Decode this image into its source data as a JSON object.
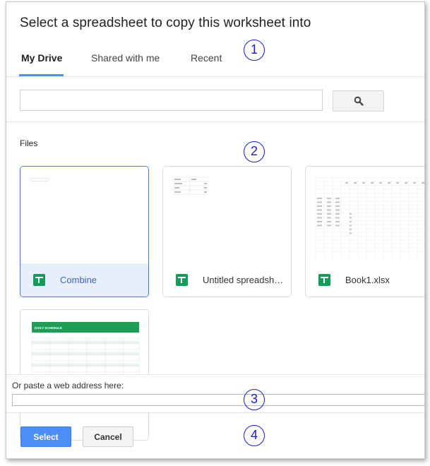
{
  "dialog": {
    "title": "Select a spreadsheet to copy this worksheet into"
  },
  "tabs": [
    {
      "label": "My Drive",
      "active": true
    },
    {
      "label": "Shared with me",
      "active": false
    },
    {
      "label": "Recent",
      "active": false
    }
  ],
  "search": {
    "value": "",
    "placeholder": "",
    "button_icon": "search-icon"
  },
  "files": {
    "label": "Files",
    "items": [
      {
        "name": "Combine",
        "selected": true,
        "icon": "sheets-icon"
      },
      {
        "name": "Untitled spreadsheet",
        "selected": false,
        "icon": "sheets-icon"
      },
      {
        "name": "Book1.xlsx",
        "selected": false,
        "icon": "sheets-icon"
      },
      {
        "name": "",
        "selected": false,
        "icon": "sheets-icon",
        "thumb_title": "DAILY SCHEDULE"
      }
    ]
  },
  "paste": {
    "label": "Or paste a web address here:",
    "value": ""
  },
  "actions": {
    "select_label": "Select",
    "cancel_label": "Cancel"
  },
  "callouts": [
    "1",
    "2",
    "3",
    "4"
  ],
  "colors": {
    "accent": "#4d90fe",
    "select_button": "#4d8ef6",
    "sheets_green": "#0f9d58",
    "selected_card_bg": "#e7eefc",
    "callout": "#1a1ad0"
  }
}
